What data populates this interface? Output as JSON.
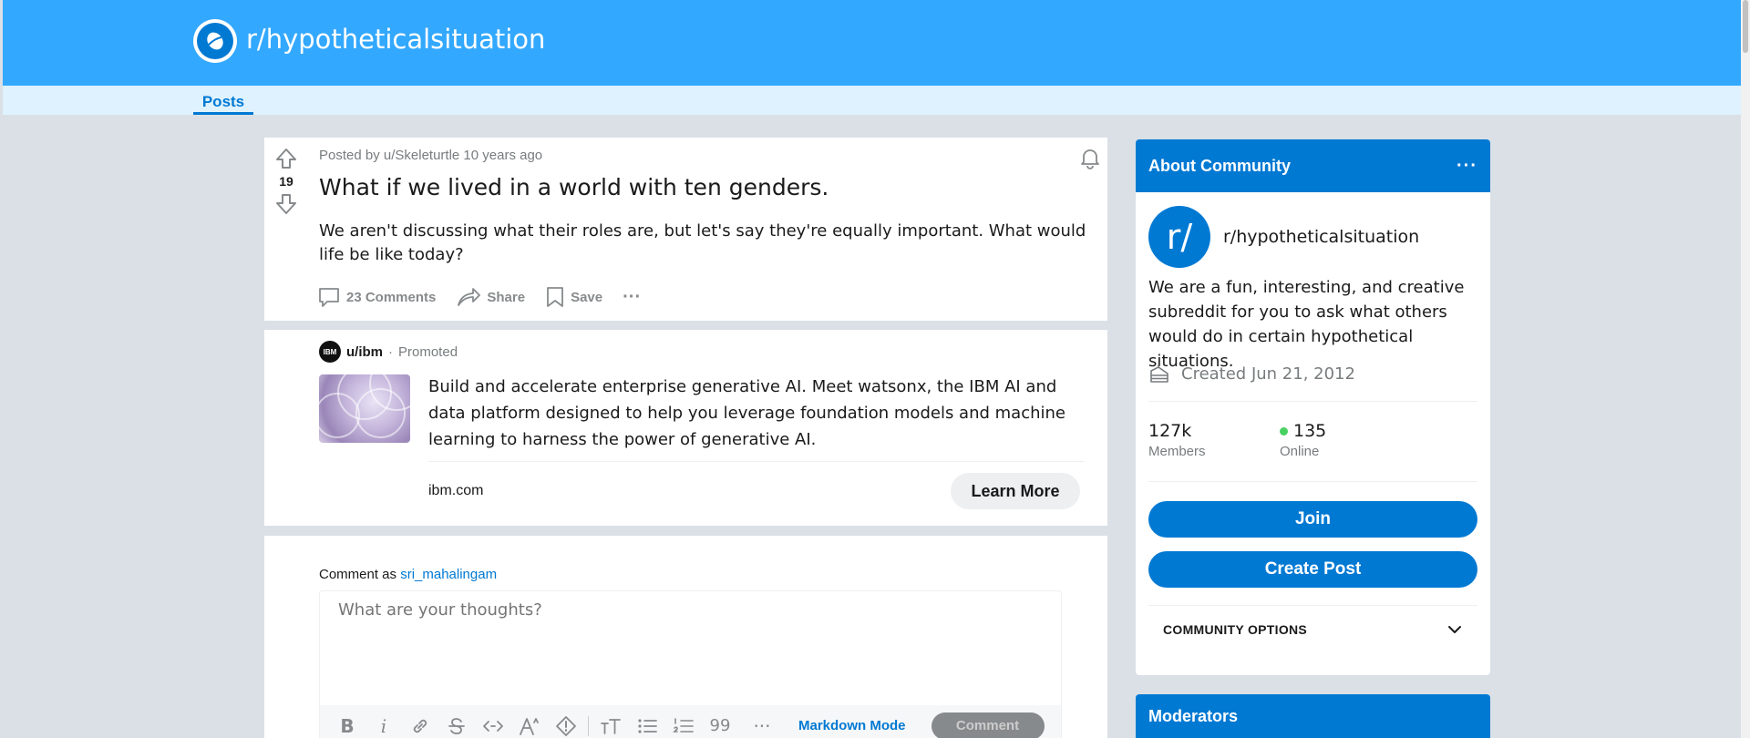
{
  "header": {
    "subreddit": "r/hypotheticalsituation"
  },
  "nav": {
    "tabs": [
      {
        "label": "Posts"
      }
    ]
  },
  "post": {
    "votes": "19",
    "meta": "Posted by u/Skeleturtle 10 years ago",
    "title": "What if we lived in a world with ten genders.",
    "body": "We aren't discussing what their roles are, but let's say they're equally important. What would life be like today?",
    "actions": {
      "comments": "23 Comments",
      "share": "Share",
      "save": "Save",
      "more": "···"
    }
  },
  "ad": {
    "logo_text": "IBM",
    "user": "u/ibm",
    "separator": "·",
    "promoted": "Promoted",
    "text": "Build and accelerate enterprise generative AI. Meet watsonx, the IBM AI and data platform designed to help you leverage foundation models and machine learning to harness the power of generative AI.",
    "domain": "ibm.com",
    "cta": "Learn More"
  },
  "comment": {
    "prefix": "Comment as",
    "username": "sri_mahalingam",
    "placeholder": "What are your thoughts?",
    "toolbar": {
      "bold": "B",
      "italic": "i",
      "quote": "99",
      "more": "···",
      "markdown_mode": "Markdown Mode",
      "submit": "Comment"
    }
  },
  "sidebar": {
    "about": {
      "title": "About Community",
      "more": "···",
      "avatar_text": "r/",
      "name": "r/hypotheticalsituation",
      "description": "We are a fun, interesting, and creative subreddit for you to ask what others would do in certain hypothetical situations.",
      "created": "Created Jun 21, 2012",
      "members_value": "127k",
      "members_label": "Members",
      "online_value": "135",
      "online_label": "Online",
      "join": "Join",
      "create_post": "Create Post",
      "options": "COMMUNITY OPTIONS"
    },
    "moderators": {
      "title": "Moderators"
    }
  },
  "colors": {
    "brand": "#0079d3",
    "banner": "#33a8ff",
    "background": "#dae0e6",
    "online": "#46d160"
  }
}
